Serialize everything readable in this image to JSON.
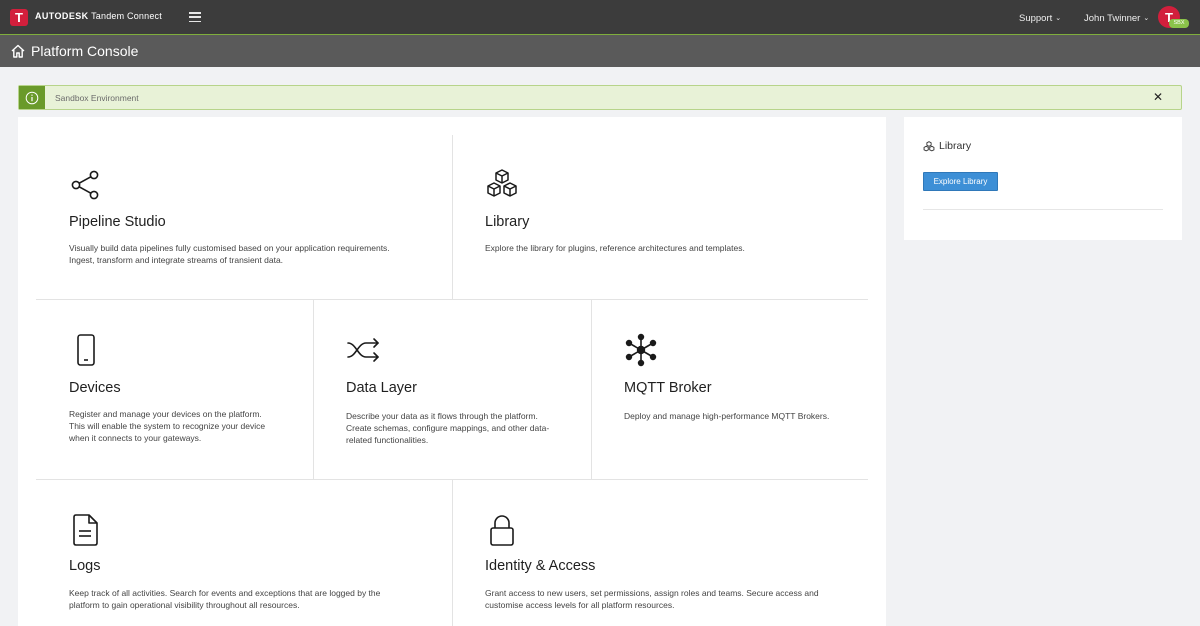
{
  "topbar": {
    "logo_letter": "T",
    "brand_bold": "AUTODESK",
    "brand_name": "Tandem Connect",
    "support_label": "Support",
    "user_name": "John Twinner",
    "avatar_letter": "T",
    "avatar_badge": "SBX"
  },
  "titlebar": {
    "title": "Platform Console"
  },
  "banner": {
    "text": "Sandbox Environment",
    "close": "✕"
  },
  "tiles": [
    {
      "title": "Pipeline Studio",
      "desc_1": "Visually build data pipelines fully customised based on your application requirements.",
      "desc_2": "Ingest, transform and integrate streams of transient data."
    },
    {
      "title": "Library",
      "desc_1": "Explore the library for plugins, reference architectures and templates."
    },
    {
      "title": "Devices",
      "desc_1": "Register and manage your devices on the platform.",
      "desc_2": "This will enable the system to recognize your device",
      "desc_3": "when it connects to your gateways."
    },
    {
      "title": "Data Layer",
      "desc_1": "Describe your data as it flows through the platform.",
      "desc_2": "Create schemas, configure mappings, and other data-",
      "desc_3": "related functionalities."
    },
    {
      "title": "MQTT Broker",
      "desc_1": "Deploy and manage high-performance MQTT Brokers."
    },
    {
      "title": "Logs",
      "desc_1": "Keep track of all activities. Search for events and exceptions that are logged by the",
      "desc_2": "platform to gain operational visibility throughout all resources."
    },
    {
      "title": "Identity & Access",
      "desc_1": "Grant access to new users, set permissions, assign roles and teams. Secure access and",
      "desc_2": "customise access levels for all platform resources."
    }
  ],
  "side_panel": {
    "title": "Library",
    "button_label": "Explore Library"
  },
  "colors": {
    "topbar": "#3c3c3c",
    "titlebar": "#5a5a5a",
    "brand_red": "#d21f3c",
    "banner_green": "#6a9a2a",
    "button_blue": "#3d8fd6"
  }
}
